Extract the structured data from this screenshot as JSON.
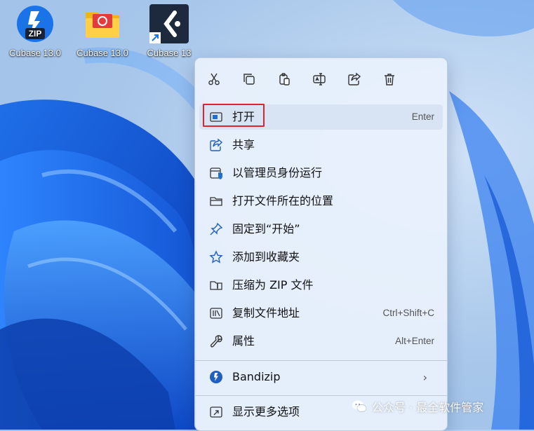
{
  "desktop": {
    "icons": [
      {
        "label": "Cubase 13.0",
        "icon": "bandizip-icon"
      },
      {
        "label": "Cubase 13.0",
        "icon": "folder-icon"
      },
      {
        "label": "Cubase 13",
        "icon": "cubase-icon"
      }
    ]
  },
  "context_menu": {
    "toolbar": [
      "cut-icon",
      "copy-icon",
      "paste-icon",
      "rename-icon",
      "share-icon",
      "delete-icon"
    ],
    "items": [
      {
        "label": "打开",
        "shortcut": "Enter"
      },
      {
        "label": "共享",
        "shortcut": ""
      },
      {
        "label": "以管理员身份运行",
        "shortcut": ""
      },
      {
        "label": "打开文件所在的位置",
        "shortcut": ""
      },
      {
        "label": "固定到“开始”",
        "shortcut": ""
      },
      {
        "label": "添加到收藏夹",
        "shortcut": ""
      },
      {
        "label": "压缩为 ZIP 文件",
        "shortcut": ""
      },
      {
        "label": "复制文件地址",
        "shortcut": "Ctrl+Shift+C"
      },
      {
        "label": "属性",
        "shortcut": "Alt+Enter"
      }
    ],
    "bandizip": {
      "label": "Bandizip",
      "chevron": "›"
    },
    "more": {
      "label": "显示更多选项"
    }
  },
  "watermark": {
    "text": "公众号 · 最全软件管家"
  },
  "colors": {
    "accent": "#0067c0",
    "highlight_border": "#e0242c",
    "menu_bg": "#e9f1fc"
  }
}
